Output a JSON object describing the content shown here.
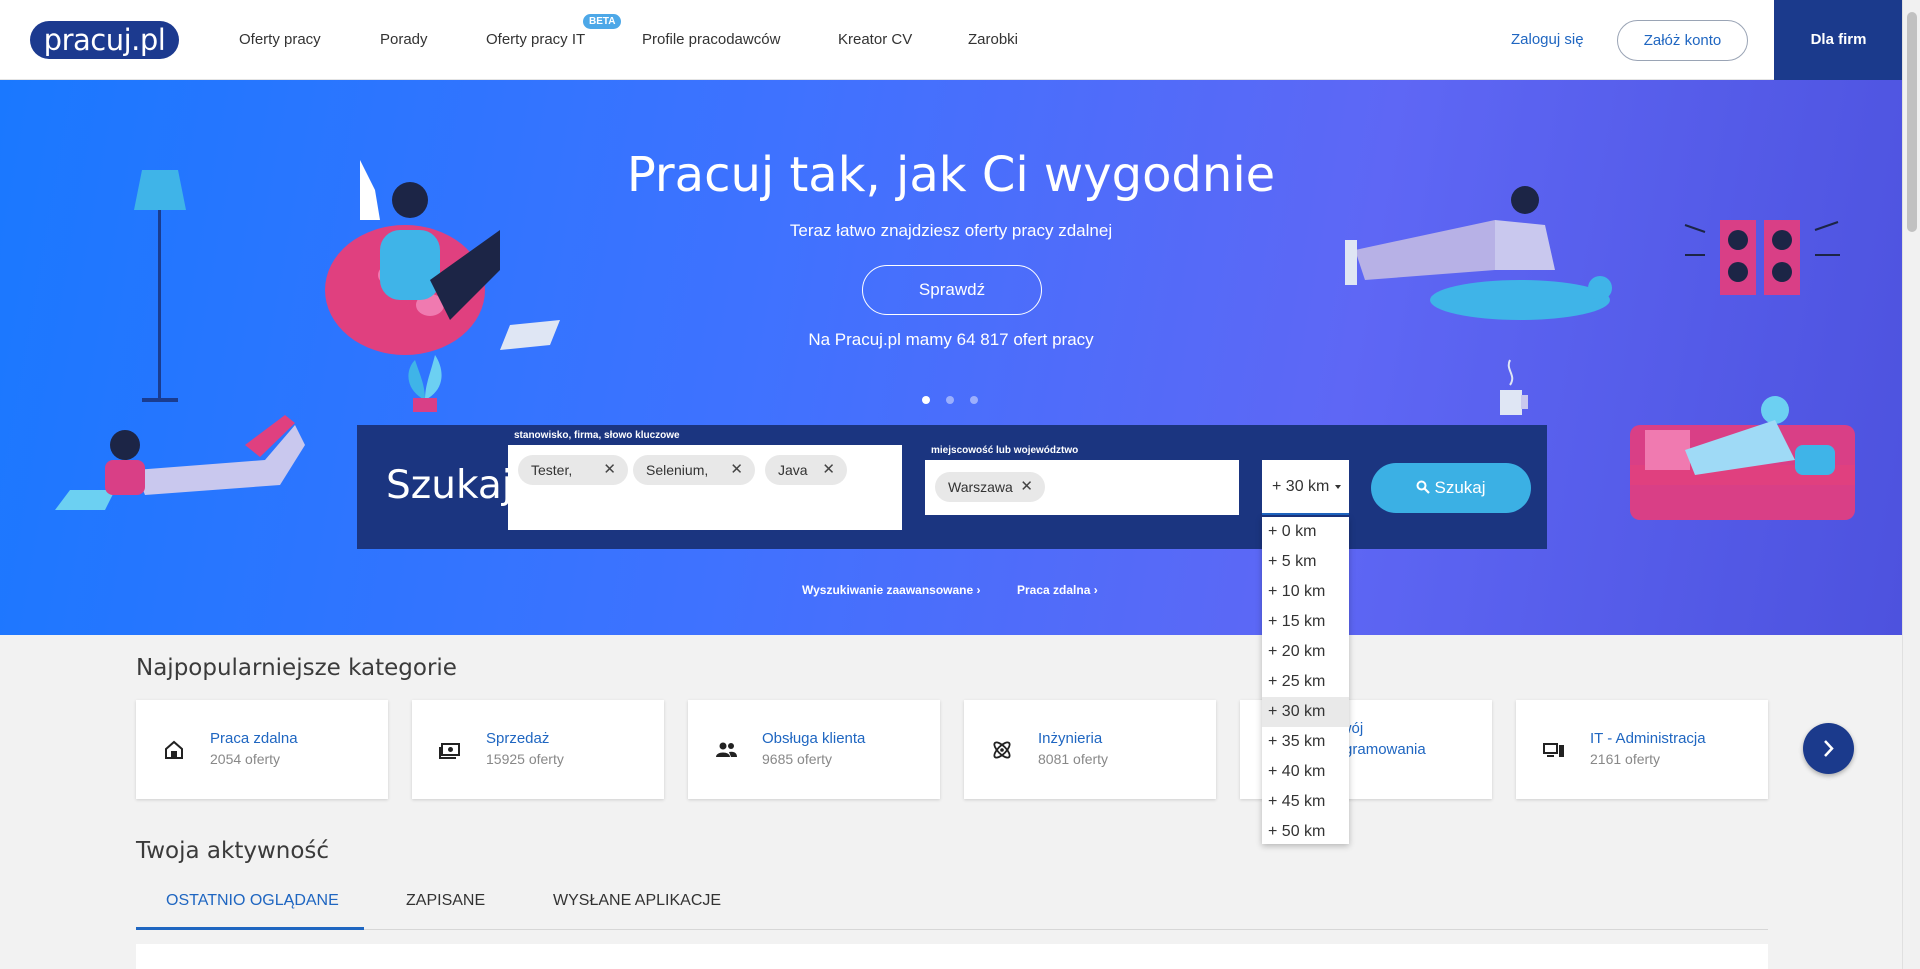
{
  "header": {
    "logo_text": "pracuj.pl",
    "nav": [
      {
        "label": "Oferty pracy"
      },
      {
        "label": "Porady"
      },
      {
        "label": "Oferty pracy IT",
        "badge": "BETA"
      },
      {
        "label": "Profile pracodawców"
      },
      {
        "label": "Kreator CV"
      },
      {
        "label": "Zarobki"
      }
    ],
    "login": "Zaloguj się",
    "register": "Załóż konto",
    "for_firms": "Dla firm"
  },
  "hero": {
    "title": "Pracuj tak, jak Ci wygodnie",
    "subtitle": "Teraz łatwo znajdziesz oferty pracy zdalnej",
    "button": "Sprawdź",
    "count_text": "Na Pracuj.pl mamy 64 817 ofert pracy",
    "carousel_active": 1
  },
  "search": {
    "title": "Szukaj",
    "keyword_label": "stanowisko, firma, słowo kluczowe",
    "keywords": [
      "Tester,",
      "Selenium,",
      "Java"
    ],
    "location_label": "miejscowość lub województwo",
    "locations": [
      "Warszawa"
    ],
    "distance_value": "+ 30 km",
    "distance_options": [
      "+ 0 km",
      "+ 5 km",
      "+ 10 km",
      "+ 15 km",
      "+ 20 km",
      "+ 25 km",
      "+ 30 km",
      "+ 35 km",
      "+ 40 km",
      "+ 45 km",
      "+ 50 km"
    ],
    "distance_selected_index": 6,
    "button": "Szukaj",
    "advanced_link": "Wyszukiwanie zaawansowane ›",
    "remote_link": "Praca zdalna ›"
  },
  "categories": {
    "title": "Najpopularniejsze kategorie",
    "items": [
      {
        "name": "Praca zdalna",
        "count": "2054 oferty",
        "icon": "home-work-icon"
      },
      {
        "name": "Sprzedaż",
        "count": "15925 oferty",
        "icon": "money-icon"
      },
      {
        "name": "Obsługa klienta",
        "count": "9685 oferty",
        "icon": "people-icon"
      },
      {
        "name": "Inżynieria",
        "count": "8081 oferty",
        "icon": "atom-icon"
      },
      {
        "name_line1": "Rozwój",
        "name_line2": "oprogramowania",
        "count": "oferty",
        "icon": "code-icon"
      },
      {
        "name": "IT - Administracja",
        "count": "2161 oferty",
        "icon": "computer-icon"
      }
    ]
  },
  "activity": {
    "title": "Twoja aktywność",
    "tabs": [
      "OSTATNIO OGLĄDANE",
      "ZAPISANE",
      "WYSŁANE APLIKACJE"
    ],
    "active_tab": 0
  },
  "colors": {
    "brand_dark": "#1b3a8c",
    "link": "#1f66c1",
    "search_button": "#3bb0e4"
  }
}
